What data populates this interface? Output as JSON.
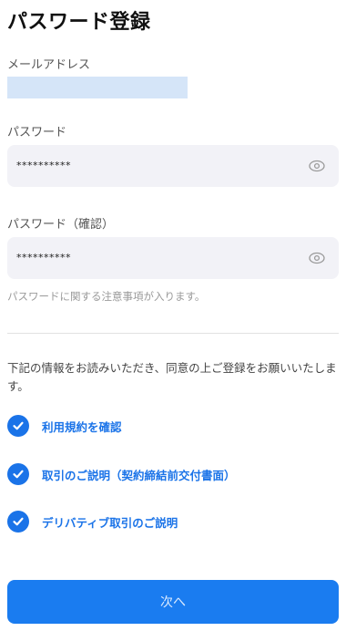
{
  "page": {
    "title": "パスワード登録"
  },
  "email": {
    "label": "メールアドレス",
    "value": ""
  },
  "password": {
    "label": "パスワード",
    "value": "**********"
  },
  "password_confirm": {
    "label": "パスワード（確認）",
    "value": "**********"
  },
  "note": "パスワードに関する注意事項が入ります。",
  "agreement": {
    "text": "下記の情報をお読みいただき、同意の上ご登録をお願いいたします。",
    "items": [
      {
        "label": "利用規約を確認",
        "checked": true
      },
      {
        "label": "取引のご説明（契約締結前交付書面）",
        "checked": true
      },
      {
        "label": "デリバティブ取引のご説明",
        "checked": true
      }
    ]
  },
  "actions": {
    "next_label": "次へ"
  },
  "colors": {
    "accent": "#1a73e8",
    "button": "#1a7cf0",
    "field_bg": "#f2f2f7",
    "email_highlight": "#d5e5f8"
  }
}
